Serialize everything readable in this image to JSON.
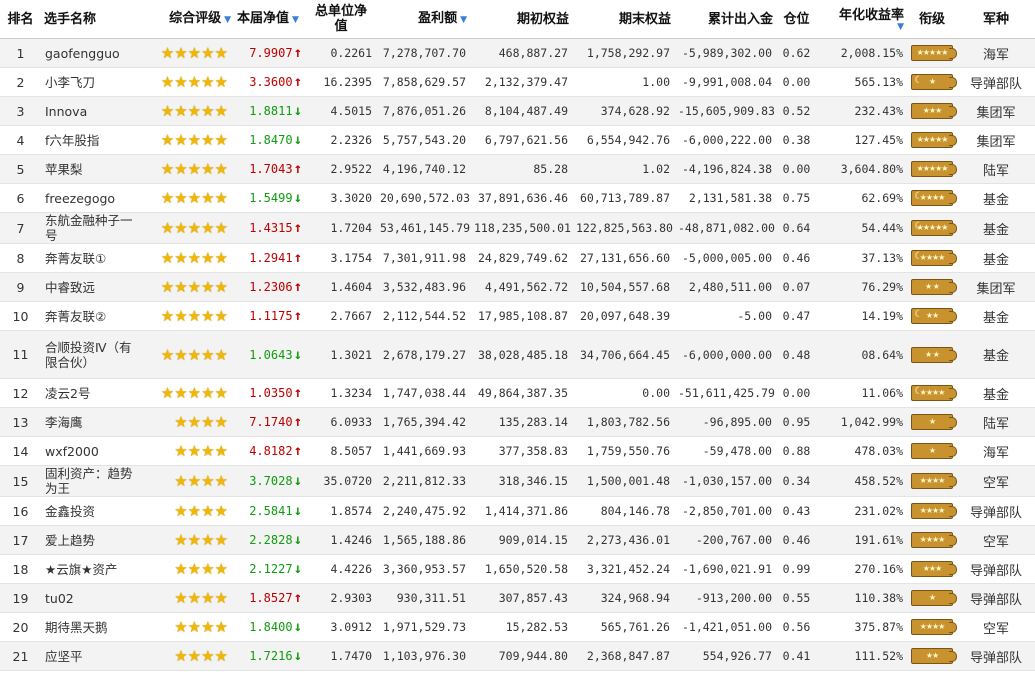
{
  "headers": {
    "rank": "排名",
    "name": "选手名称",
    "rating": "综合评级",
    "nav": "本届净值",
    "unit_nav": "总单位净值",
    "profit": "盈利额",
    "start_equity": "期初权益",
    "end_equity": "期末权益",
    "cum_flow": "累计出入金",
    "position": "仓位",
    "annual_return": "年化收益率",
    "grade": "衔级",
    "branch": "军种"
  },
  "sort_icon": "sort-down-triangle",
  "colors": {
    "up": "#c00000",
    "down": "#0f9d0f",
    "star": "#f2b705",
    "badge": "#c8932e",
    "row_alt": "#f3f3f3"
  },
  "rows": [
    {
      "rank": "1",
      "name": "gaofengguo",
      "stars": 5,
      "nav": "7.9907",
      "dir": "up",
      "unit_nav": "0.2261",
      "profit": "7,278,707.70",
      "start_equity": "468,887.27",
      "end_equity": "1,758,292.97",
      "cum_flow": "-5,989,302.00",
      "position": "0.62",
      "annual_return": "2,008.15%",
      "grade": "★★★★★",
      "grade_moon": false,
      "branch": "海军"
    },
    {
      "rank": "2",
      "name": "小李飞刀",
      "stars": 5,
      "nav": "3.3600",
      "dir": "up",
      "unit_nav": "16.2395",
      "profit": "7,858,629.57",
      "start_equity": "2,132,379.47",
      "end_equity": "1.00",
      "cum_flow": "-9,991,008.04",
      "position": "0.00",
      "annual_return": "565.13%",
      "grade": "★",
      "grade_moon": true,
      "branch": "导弹部队"
    },
    {
      "rank": "3",
      "name": "Innova",
      "stars": 5,
      "nav": "1.8811",
      "dir": "down",
      "unit_nav": "4.5015",
      "profit": "7,876,051.26",
      "start_equity": "8,104,487.49",
      "end_equity": "374,628.92",
      "cum_flow": "-15,605,909.83",
      "position": "0.52",
      "annual_return": "232.43%",
      "grade": "★★★",
      "grade_moon": false,
      "branch": "集团军"
    },
    {
      "rank": "4",
      "name": "f六年股指",
      "stars": 5,
      "nav": "1.8470",
      "dir": "down",
      "unit_nav": "2.2326",
      "profit": "5,757,543.20",
      "start_equity": "6,797,621.56",
      "end_equity": "6,554,942.76",
      "cum_flow": "-6,000,222.00",
      "position": "0.38",
      "annual_return": "127.45%",
      "grade": "★★★★★",
      "grade_moon": false,
      "branch": "集团军"
    },
    {
      "rank": "5",
      "name": "苹果梨",
      "stars": 5,
      "nav": "1.7043",
      "dir": "up",
      "unit_nav": "2.9522",
      "profit": "4,196,740.12",
      "start_equity": "85.28",
      "end_equity": "1.02",
      "cum_flow": "-4,196,824.38",
      "position": "0.00",
      "annual_return": "3,604.80%",
      "grade": "★★★★★",
      "grade_moon": false,
      "branch": "陆军"
    },
    {
      "rank": "6",
      "name": "freezegogo",
      "stars": 5,
      "nav": "1.5499",
      "dir": "down",
      "unit_nav": "3.3020",
      "profit": "20,690,572.03",
      "start_equity": "37,891,636.46",
      "end_equity": "60,713,789.87",
      "cum_flow": "2,131,581.38",
      "position": "0.75",
      "annual_return": "62.69%",
      "grade": "★★★★",
      "grade_moon": true,
      "branch": "基金"
    },
    {
      "rank": "7",
      "name": "东航金融种子一号",
      "stars": 5,
      "nav": "1.4315",
      "dir": "up",
      "unit_nav": "1.7204",
      "profit": "53,461,145.79",
      "start_equity": "118,235,500.01",
      "end_equity": "122,825,563.80",
      "cum_flow": "-48,871,082.00",
      "position": "0.64",
      "annual_return": "54.44%",
      "grade": "★★★★★",
      "grade_moon": true,
      "branch": "基金"
    },
    {
      "rank": "8",
      "name": "奔菁友联①",
      "stars": 5,
      "nav": "1.2941",
      "dir": "up",
      "unit_nav": "3.1754",
      "profit": "7,301,911.98",
      "start_equity": "24,829,749.62",
      "end_equity": "27,131,656.60",
      "cum_flow": "-5,000,005.00",
      "position": "0.46",
      "annual_return": "37.13%",
      "grade": "★★★★",
      "grade_moon": true,
      "branch": "基金"
    },
    {
      "rank": "9",
      "name": "中睿致远",
      "stars": 5,
      "nav": "1.2306",
      "dir": "up",
      "unit_nav": "1.4604",
      "profit": "3,532,483.96",
      "start_equity": "4,491,562.72",
      "end_equity": "10,504,557.68",
      "cum_flow": "2,480,511.00",
      "position": "0.07",
      "annual_return": "76.29%",
      "grade": "★ ★",
      "grade_moon": false,
      "branch": "集团军"
    },
    {
      "rank": "10",
      "name": "奔菁友联②",
      "stars": 5,
      "nav": "1.1175",
      "dir": "up",
      "unit_nav": "2.7667",
      "profit": "2,112,544.52",
      "start_equity": "17,985,108.87",
      "end_equity": "20,097,648.39",
      "cum_flow": "-5.00",
      "position": "0.47",
      "annual_return": "14.19%",
      "grade": "★★",
      "grade_moon": true,
      "branch": "基金"
    },
    {
      "rank": "11",
      "name": "合顺投资Ⅳ（有限合伙）",
      "stars": 5,
      "nav": "1.0643",
      "dir": "down",
      "unit_nav": "1.3021",
      "profit": "2,678,179.27",
      "start_equity": "38,028,485.18",
      "end_equity": "34,706,664.45",
      "cum_flow": "-6,000,000.00",
      "position": "0.48",
      "annual_return": "08.64%",
      "grade": "★ ★",
      "grade_moon": false,
      "branch": "基金"
    },
    {
      "rank": "12",
      "name": "凌云2号",
      "stars": 5,
      "nav": "1.0350",
      "dir": "up",
      "unit_nav": "1.3234",
      "profit": "1,747,038.44",
      "start_equity": "49,864,387.35",
      "end_equity": "0.00",
      "cum_flow": "-51,611,425.79",
      "position": "0.00",
      "annual_return": "11.06%",
      "grade": "★★★★",
      "grade_moon": true,
      "branch": "基金"
    },
    {
      "rank": "13",
      "name": "李海鹰",
      "stars": 4,
      "nav": "7.1740",
      "dir": "up",
      "unit_nav": "6.0933",
      "profit": "1,765,394.42",
      "start_equity": "135,283.14",
      "end_equity": "1,803,782.56",
      "cum_flow": "-96,895.00",
      "position": "0.95",
      "annual_return": "1,042.99%",
      "grade": "★",
      "grade_moon": false,
      "branch": "陆军"
    },
    {
      "rank": "14",
      "name": "wxf2000",
      "stars": 4,
      "nav": "4.8182",
      "dir": "up",
      "unit_nav": "8.5057",
      "profit": "1,441,669.93",
      "start_equity": "377,358.83",
      "end_equity": "1,759,550.76",
      "cum_flow": "-59,478.00",
      "position": "0.88",
      "annual_return": "478.03%",
      "grade": "★",
      "grade_moon": false,
      "branch": "海军"
    },
    {
      "rank": "15",
      "name": "固利资产：趋势为王",
      "stars": 4,
      "nav": "3.7028",
      "dir": "down",
      "unit_nav": "35.0720",
      "profit": "2,211,812.33",
      "start_equity": "318,346.15",
      "end_equity": "1,500,001.48",
      "cum_flow": "-1,030,157.00",
      "position": "0.34",
      "annual_return": "458.52%",
      "grade": "★★★★",
      "grade_moon": false,
      "branch": "空军"
    },
    {
      "rank": "16",
      "name": "金鑫投资",
      "stars": 4,
      "nav": "2.5841",
      "dir": "down",
      "unit_nav": "1.8574",
      "profit": "2,240,475.92",
      "start_equity": "1,414,371.86",
      "end_equity": "804,146.78",
      "cum_flow": "-2,850,701.00",
      "position": "0.43",
      "annual_return": "231.02%",
      "grade": "★★★★",
      "grade_moon": false,
      "branch": "导弹部队"
    },
    {
      "rank": "17",
      "name": "爱上趋势",
      "stars": 4,
      "nav": "2.2828",
      "dir": "down",
      "unit_nav": "1.4246",
      "profit": "1,565,188.86",
      "start_equity": "909,014.15",
      "end_equity": "2,273,436.01",
      "cum_flow": "-200,767.00",
      "position": "0.46",
      "annual_return": "191.61%",
      "grade": "★★★★",
      "grade_moon": false,
      "branch": "空军"
    },
    {
      "rank": "18",
      "name": "★云旗★资产",
      "stars": 4,
      "nav": "2.1227",
      "dir": "down",
      "unit_nav": "4.4226",
      "profit": "3,360,953.57",
      "start_equity": "1,650,520.58",
      "end_equity": "3,321,452.24",
      "cum_flow": "-1,690,021.91",
      "position": "0.99",
      "annual_return": "270.16%",
      "grade": "★★★",
      "grade_moon": false,
      "branch": "导弹部队"
    },
    {
      "rank": "19",
      "name": "tu02",
      "stars": 4,
      "nav": "1.8527",
      "dir": "up",
      "unit_nav": "2.9303",
      "profit": "930,311.51",
      "start_equity": "307,857.43",
      "end_equity": "324,968.94",
      "cum_flow": "-913,200.00",
      "position": "0.55",
      "annual_return": "110.38%",
      "grade": "★",
      "grade_moon": false,
      "branch": "导弹部队"
    },
    {
      "rank": "20",
      "name": "期待黑天鹅",
      "stars": 4,
      "nav": "1.8400",
      "dir": "down",
      "unit_nav": "3.0912",
      "profit": "1,971,529.73",
      "start_equity": "15,282.53",
      "end_equity": "565,761.26",
      "cum_flow": "-1,421,051.00",
      "position": "0.56",
      "annual_return": "375.87%",
      "grade": "★★★★",
      "grade_moon": false,
      "branch": "空军"
    },
    {
      "rank": "21",
      "name": "应坚平",
      "stars": 4,
      "nav": "1.7216",
      "dir": "down",
      "unit_nav": "1.7470",
      "profit": "1,103,976.30",
      "start_equity": "709,944.80",
      "end_equity": "2,368,847.87",
      "cum_flow": "554,926.77",
      "position": "0.41",
      "annual_return": "111.52%",
      "grade": "★★",
      "grade_moon": false,
      "branch": "导弹部队"
    }
  ]
}
